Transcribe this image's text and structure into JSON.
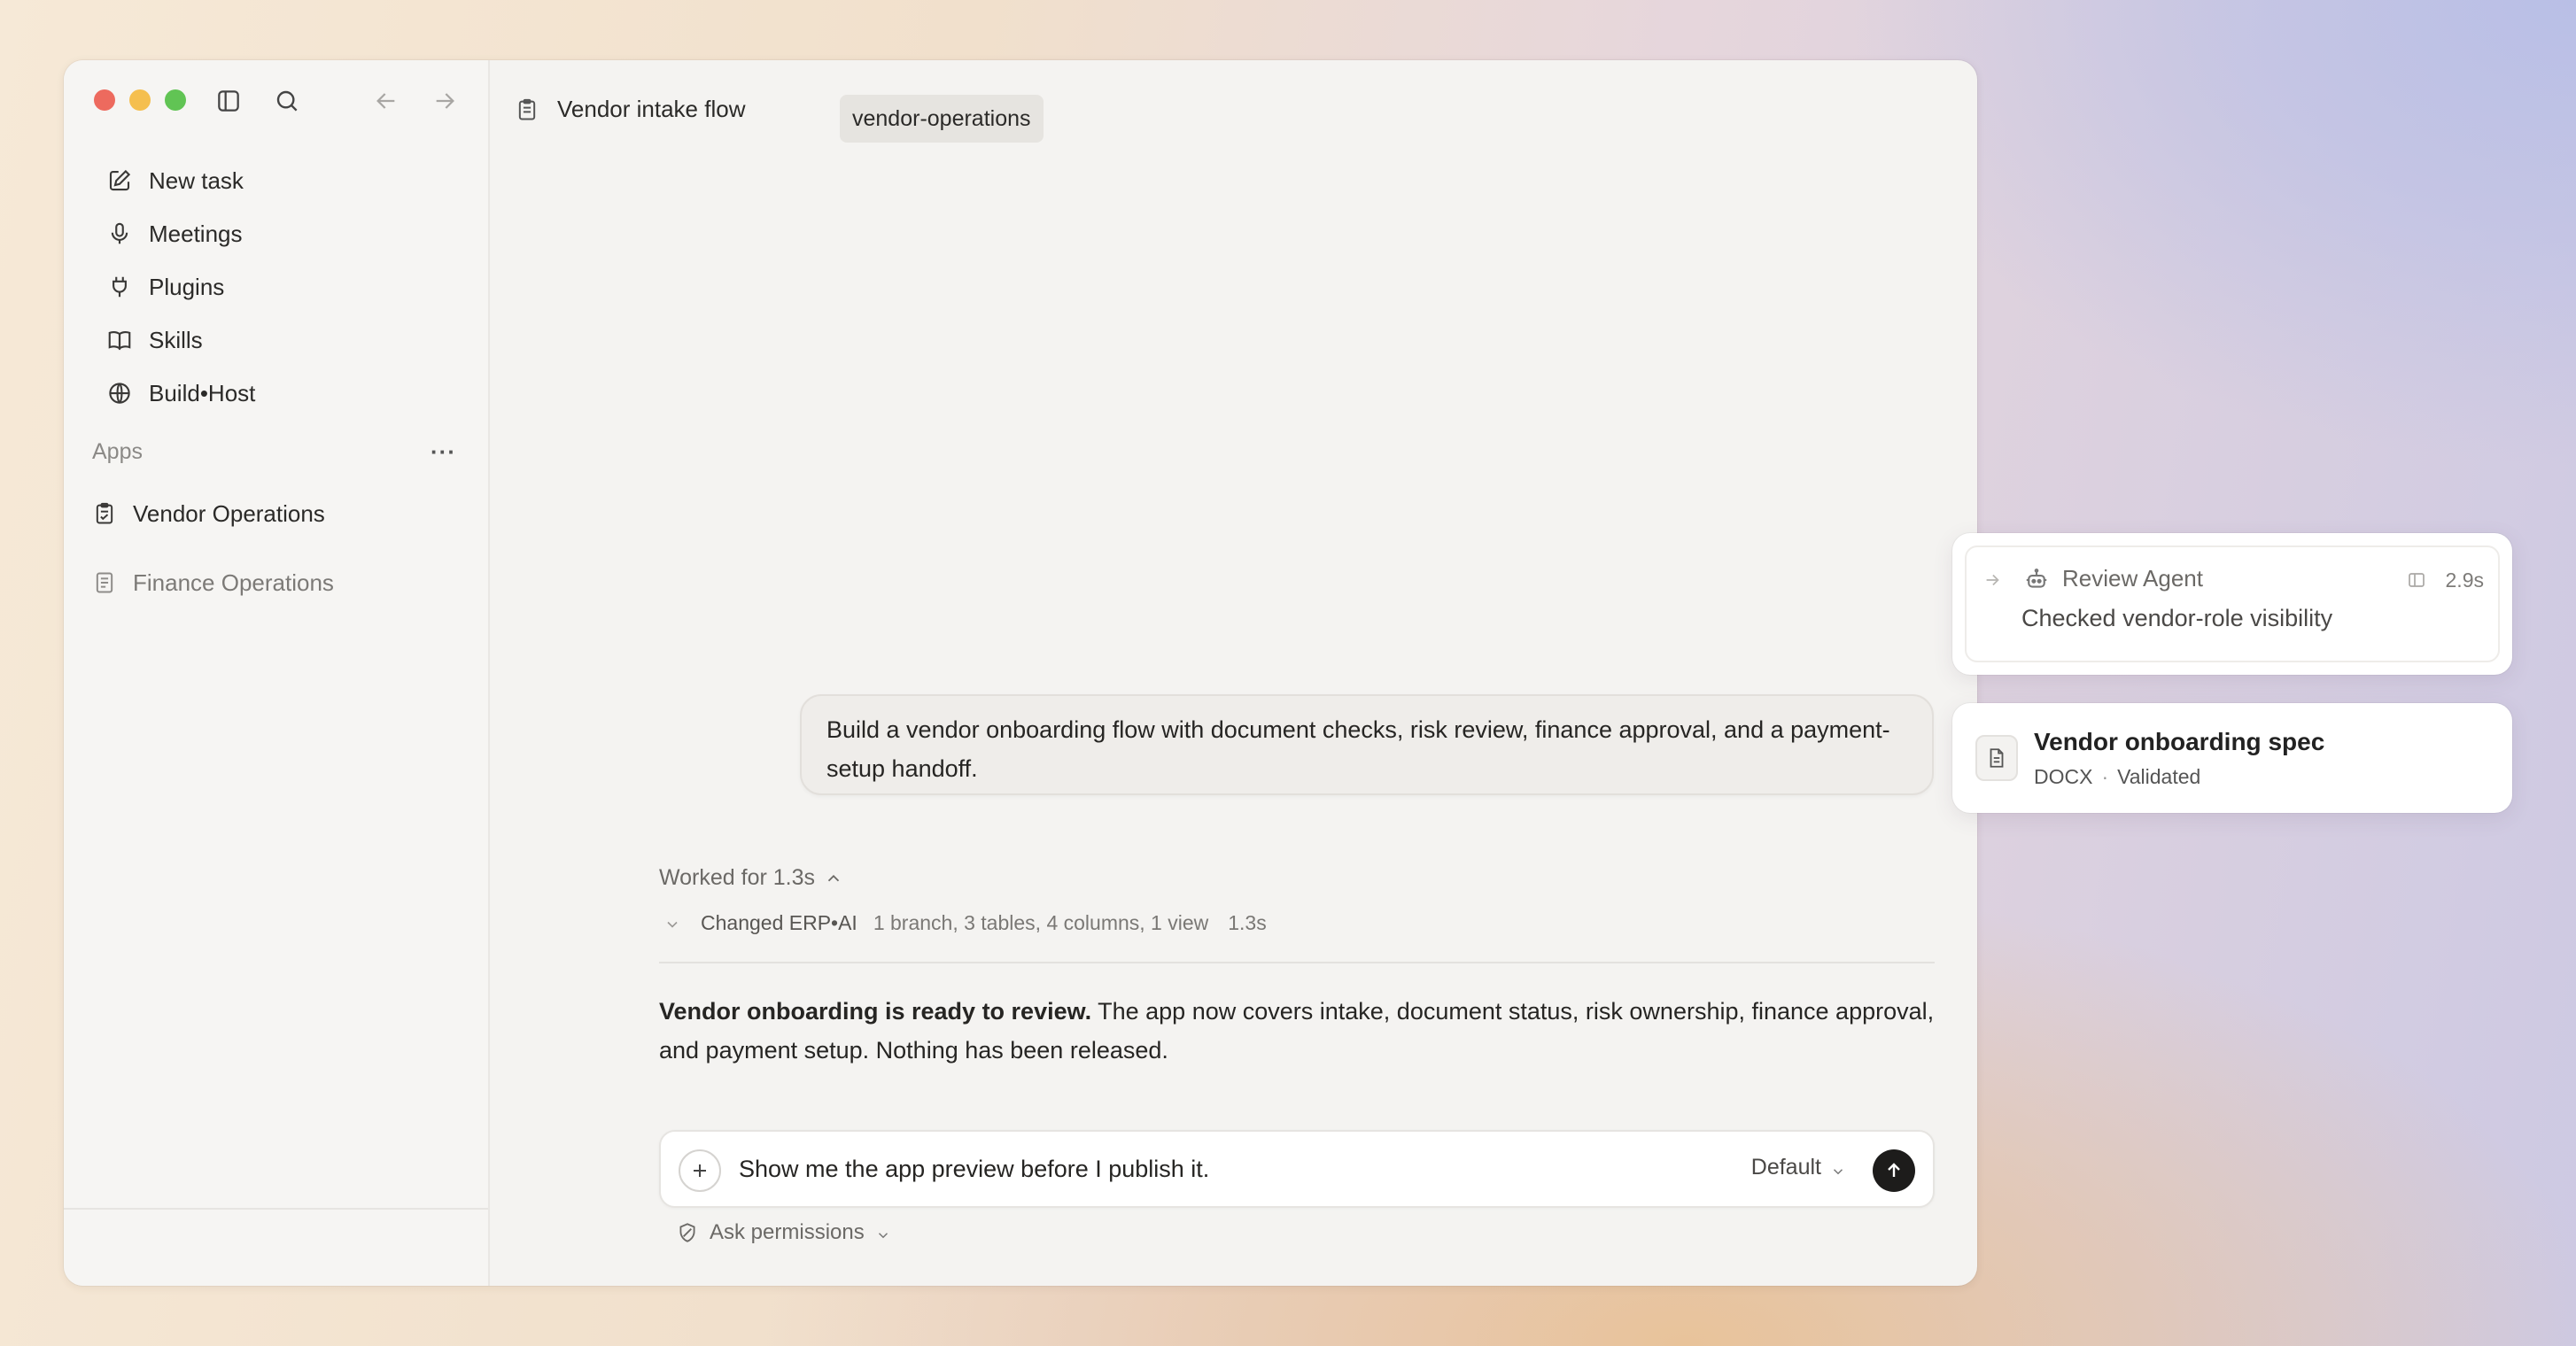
{
  "sidebar": {
    "nav": [
      {
        "label": "New task",
        "icon": "pencil-square-icon"
      },
      {
        "label": "Meetings",
        "icon": "microphone-icon"
      },
      {
        "label": "Plugins",
        "icon": "plug-icon"
      },
      {
        "label": "Skills",
        "icon": "book-icon"
      },
      {
        "label": "Build•Host",
        "icon": "globe-icon"
      }
    ],
    "apps_heading": "Apps",
    "apps_more": "···",
    "apps": [
      {
        "label": "Vendor Operations",
        "icon": "clipboard-check-icon",
        "active": true
      },
      {
        "label": "Finance Operations",
        "icon": "document-list-icon",
        "active": false
      }
    ]
  },
  "header": {
    "title": "Vendor intake flow",
    "tag": "vendor-operations"
  },
  "conversation": {
    "user_message": "Build a vendor onboarding flow with document checks, risk review, finance approval, and a payment-setup handoff.",
    "worked_label": "Worked for 1.3s",
    "change": {
      "name": "Changed ERP•AI",
      "meta": "1 branch, 3 tables, 4 columns, 1 view",
      "duration": "1.3s"
    },
    "response_bold": "Vendor onboarding is ready to review.",
    "response_text": " The app now covers intake, document status, risk ownership, finance approval, and payment setup. Nothing has been released."
  },
  "composer": {
    "value": "Show me the app preview before I publish it.",
    "mode": "Default",
    "permissions": "Ask permissions"
  },
  "agent_card": {
    "name": "Review Agent",
    "time": "2.9s",
    "description": "Checked vendor-role visibility"
  },
  "spec_card": {
    "name": "Vendor onboarding spec",
    "format": "DOCX",
    "separator": "·",
    "status": "Validated"
  },
  "colors": {
    "send_button": "#1d1c1b",
    "traffic_red": "#ed6a5e",
    "traffic_yellow": "#f5bf4f",
    "traffic_green": "#61c454"
  }
}
